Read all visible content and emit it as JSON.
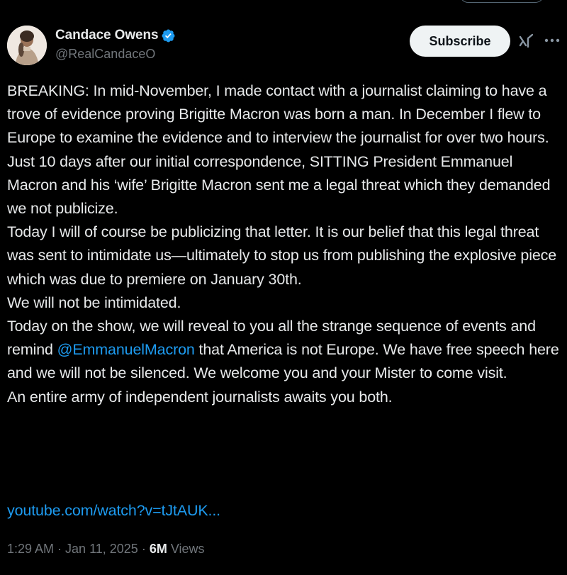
{
  "author": {
    "display_name": "Candace Owens",
    "handle": "@RealCandaceO",
    "verified": true,
    "avatar_icon": "profile-photo"
  },
  "actions": {
    "subscribe_label": "Subscribe",
    "grok_icon": "grok-icon",
    "more_icon": "more-icon"
  },
  "tweet": {
    "paragraphs": [
      "BREAKING: In mid-November, I made contact with a journalist claiming to have a trove of evidence proving Brigitte Macron was born a man. In December I flew to Europe to examine the evidence and to interview the journalist for over two hours.",
      "Just 10 days after our initial correspondence, SITTING President Emmanuel Macron and his ‘wife’ Brigitte Macron sent me a legal threat which they demanded we not publicize.",
      "Today I will of course be publicizing that letter. It is our belief that this legal threat was sent to intimidate us—ultimately to stop us from publishing the explosive piece which was due to premiere on January 30th.",
      "We will not be intimidated.",
      "An entire army of independent journalists awaits you both."
    ],
    "paragraph5": {
      "before": "Today on the show, we will reveal to you all the strange sequence of events and remind ",
      "mention": "@EmmanuelMacron",
      "after": " that America is not Europe. We have free speech here and we will not be silenced. We welcome you and your Mister to come visit."
    },
    "link": "youtube.com/watch?v=tJtAUK...",
    "time": "1:29 AM",
    "separator": "·",
    "date": "Jan 11, 2025",
    "views_count": "6M",
    "views_label": "Views"
  },
  "colors": {
    "background": "#000000",
    "text": "#e7e9ea",
    "secondary": "#71767b",
    "link": "#1d9bf0",
    "verified": "#1d9bf0",
    "subscribe_bg": "#eff3f4"
  }
}
